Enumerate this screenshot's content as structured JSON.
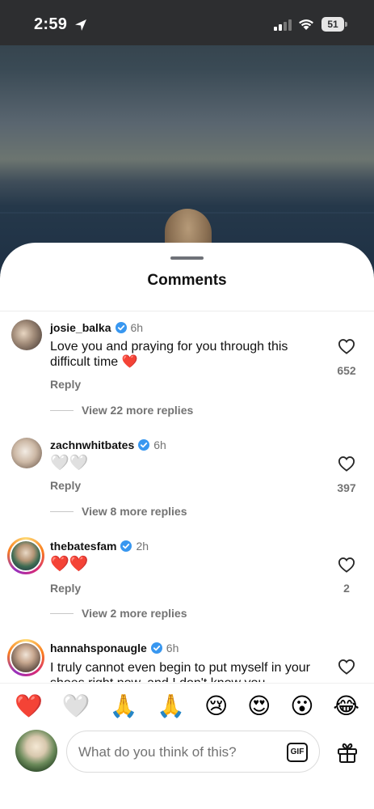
{
  "status_bar": {
    "time": "2:59",
    "battery": "51"
  },
  "sheet": {
    "title": "Comments"
  },
  "comments": [
    {
      "username": "josie_balka",
      "time": "6h",
      "text": "Love you and praying for you through this difficult time ❤️",
      "reply_label": "Reply",
      "view_replies": "View 22 more replies",
      "likes": "652"
    },
    {
      "username": "zachnwhitbates",
      "time": "6h",
      "text": "🤍🤍",
      "reply_label": "Reply",
      "view_replies": "View 8 more replies",
      "likes": "397"
    },
    {
      "username": "thebatesfam",
      "time": "2h",
      "text": "❤️❤️",
      "reply_label": "Reply",
      "view_replies": "View 2 more replies",
      "likes": "2"
    },
    {
      "username": "hannahsponaugle",
      "time": "6h",
      "text": "I truly cannot even begin to put myself in your shoes right now, and I don't know you"
    }
  ],
  "emoji_bar": [
    "❤️",
    "🤍",
    "🙏",
    "🙏",
    "😢",
    "😍",
    "😮",
    "😂"
  ],
  "input": {
    "placeholder": "What do you think of this?",
    "gif_label": "GIF"
  },
  "colors": {
    "verified": "#3897f0",
    "muted": "#737373",
    "heart": "#e0245e"
  }
}
